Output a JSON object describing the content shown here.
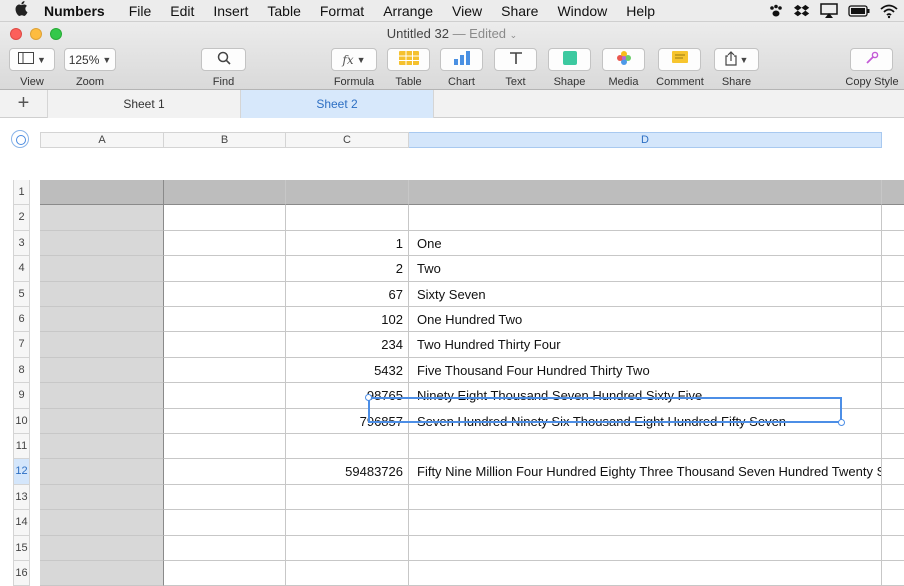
{
  "menubar": {
    "items": [
      "Numbers",
      "File",
      "Edit",
      "Insert",
      "Table",
      "Format",
      "Arrange",
      "View",
      "Share",
      "Window",
      "Help"
    ],
    "status_icons": [
      "paw-icon",
      "dropbox-icon",
      "airplay-icon",
      "battery-icon",
      "wifi-icon"
    ]
  },
  "window": {
    "title": "Untitled 32",
    "edited_suffix": "— Edited"
  },
  "toolbar": {
    "view_label": "View",
    "zoom_value": "125%",
    "zoom_label": "Zoom",
    "find_label": "Find",
    "formula_label": "Formula",
    "formula_glyph": "fx",
    "table_label": "Table",
    "chart_label": "Chart",
    "text_label": "Text",
    "shape_label": "Shape",
    "media_label": "Media",
    "comment_label": "Comment",
    "share_label": "Share",
    "copy_style_label": "Copy Style"
  },
  "sheets": {
    "add_glyph": "+",
    "tabs": [
      "Sheet 1",
      "Sheet 2"
    ],
    "active": "Sheet 2"
  },
  "grid": {
    "columns": [
      "A",
      "B",
      "C",
      "D"
    ],
    "selected_column": "D",
    "row_numbers": [
      "1",
      "2",
      "3",
      "4",
      "5",
      "6",
      "7",
      "8",
      "9",
      "10",
      "11",
      "12",
      "13",
      "14",
      "15",
      "16"
    ],
    "selected_row": "12",
    "rows": [
      {
        "c": "",
        "d": ""
      },
      {
        "c": "",
        "d": ""
      },
      {
        "c": "1",
        "d": "One"
      },
      {
        "c": "2",
        "d": "Two"
      },
      {
        "c": "67",
        "d": "Sixty Seven"
      },
      {
        "c": "102",
        "d": "One Hundred Two"
      },
      {
        "c": "234",
        "d": "Two Hundred Thirty Four"
      },
      {
        "c": "5432",
        "d": "Five Thousand Four Hundred Thirty Two"
      },
      {
        "c": "98765",
        "d": "Ninety Eight Thousand Seven Hundred Sixty Five"
      },
      {
        "c": "796857",
        "d": "Seven Hundred Ninety Six Thousand Eight Hundred Fifty Seven"
      },
      {
        "c": "",
        "d": ""
      },
      {
        "c": "59483726",
        "d": "Fifty Nine Million Four Hundred Eighty Three Thousand Seven Hundred Twenty Six"
      },
      {
        "c": "",
        "d": ""
      },
      {
        "c": "",
        "d": ""
      },
      {
        "c": "",
        "d": ""
      },
      {
        "c": "",
        "d": ""
      }
    ]
  },
  "colors": {
    "selection": "#4c8ee6",
    "header_row": "#bdbdbd",
    "header_column": "#d8d8d8"
  }
}
